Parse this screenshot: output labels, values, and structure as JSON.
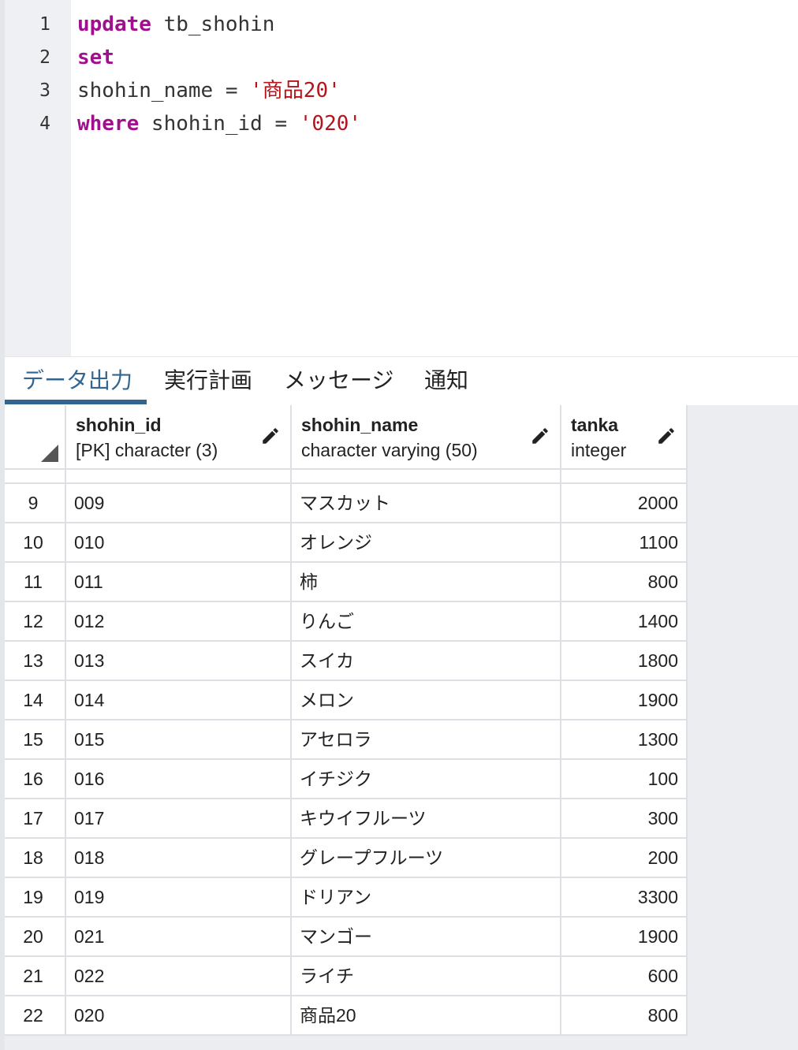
{
  "editor": {
    "line_numbers": [
      "1",
      "2",
      "3",
      "4"
    ],
    "lines": [
      {
        "kw": "update",
        "rest": " tb_shohin",
        "str": ""
      },
      {
        "kw": "set",
        "rest": "",
        "str": ""
      },
      {
        "kw": "",
        "rest": "shohin_name = ",
        "str": "'商品20'"
      },
      {
        "kw": "where",
        "rest": " shohin_id = ",
        "str": "'020'"
      }
    ]
  },
  "tabs": {
    "items": [
      {
        "label": "データ出力",
        "active": true
      },
      {
        "label": "実行計画",
        "active": false
      },
      {
        "label": "メッセージ",
        "active": false
      },
      {
        "label": "通知",
        "active": false
      }
    ]
  },
  "grid": {
    "columns": [
      {
        "name": "shohin_id",
        "type": "[PK] character (3)"
      },
      {
        "name": "shohin_name",
        "type": "character varying (50)"
      },
      {
        "name": "tanka",
        "type": "integer"
      }
    ],
    "rows": [
      {
        "no": "9",
        "shohin_id": "009",
        "shohin_name": "マスカット",
        "tanka": "2000"
      },
      {
        "no": "10",
        "shohin_id": "010",
        "shohin_name": "オレンジ",
        "tanka": "1100"
      },
      {
        "no": "11",
        "shohin_id": "011",
        "shohin_name": "柿",
        "tanka": "800"
      },
      {
        "no": "12",
        "shohin_id": "012",
        "shohin_name": "りんご",
        "tanka": "1400"
      },
      {
        "no": "13",
        "shohin_id": "013",
        "shohin_name": "スイカ",
        "tanka": "1800"
      },
      {
        "no": "14",
        "shohin_id": "014",
        "shohin_name": "メロン",
        "tanka": "1900"
      },
      {
        "no": "15",
        "shohin_id": "015",
        "shohin_name": "アセロラ",
        "tanka": "1300"
      },
      {
        "no": "16",
        "shohin_id": "016",
        "shohin_name": "イチジク",
        "tanka": "100"
      },
      {
        "no": "17",
        "shohin_id": "017",
        "shohin_name": "キウイフルーツ",
        "tanka": "300"
      },
      {
        "no": "18",
        "shohin_id": "018",
        "shohin_name": "グレープフルーツ",
        "tanka": "200"
      },
      {
        "no": "19",
        "shohin_id": "019",
        "shohin_name": "ドリアン",
        "tanka": "3300"
      },
      {
        "no": "20",
        "shohin_id": "021",
        "shohin_name": "マンゴー",
        "tanka": "1900"
      },
      {
        "no": "21",
        "shohin_id": "022",
        "shohin_name": "ライチ",
        "tanka": "600"
      },
      {
        "no": "22",
        "shohin_id": "020",
        "shohin_name": "商品20",
        "tanka": "800"
      }
    ]
  },
  "colors": {
    "keyword": "#a0108e",
    "string": "#b3151b",
    "tab_active": "#326690"
  },
  "icons": {
    "edit": "pencil-icon",
    "sort_corner": "corner-triangle-icon"
  }
}
